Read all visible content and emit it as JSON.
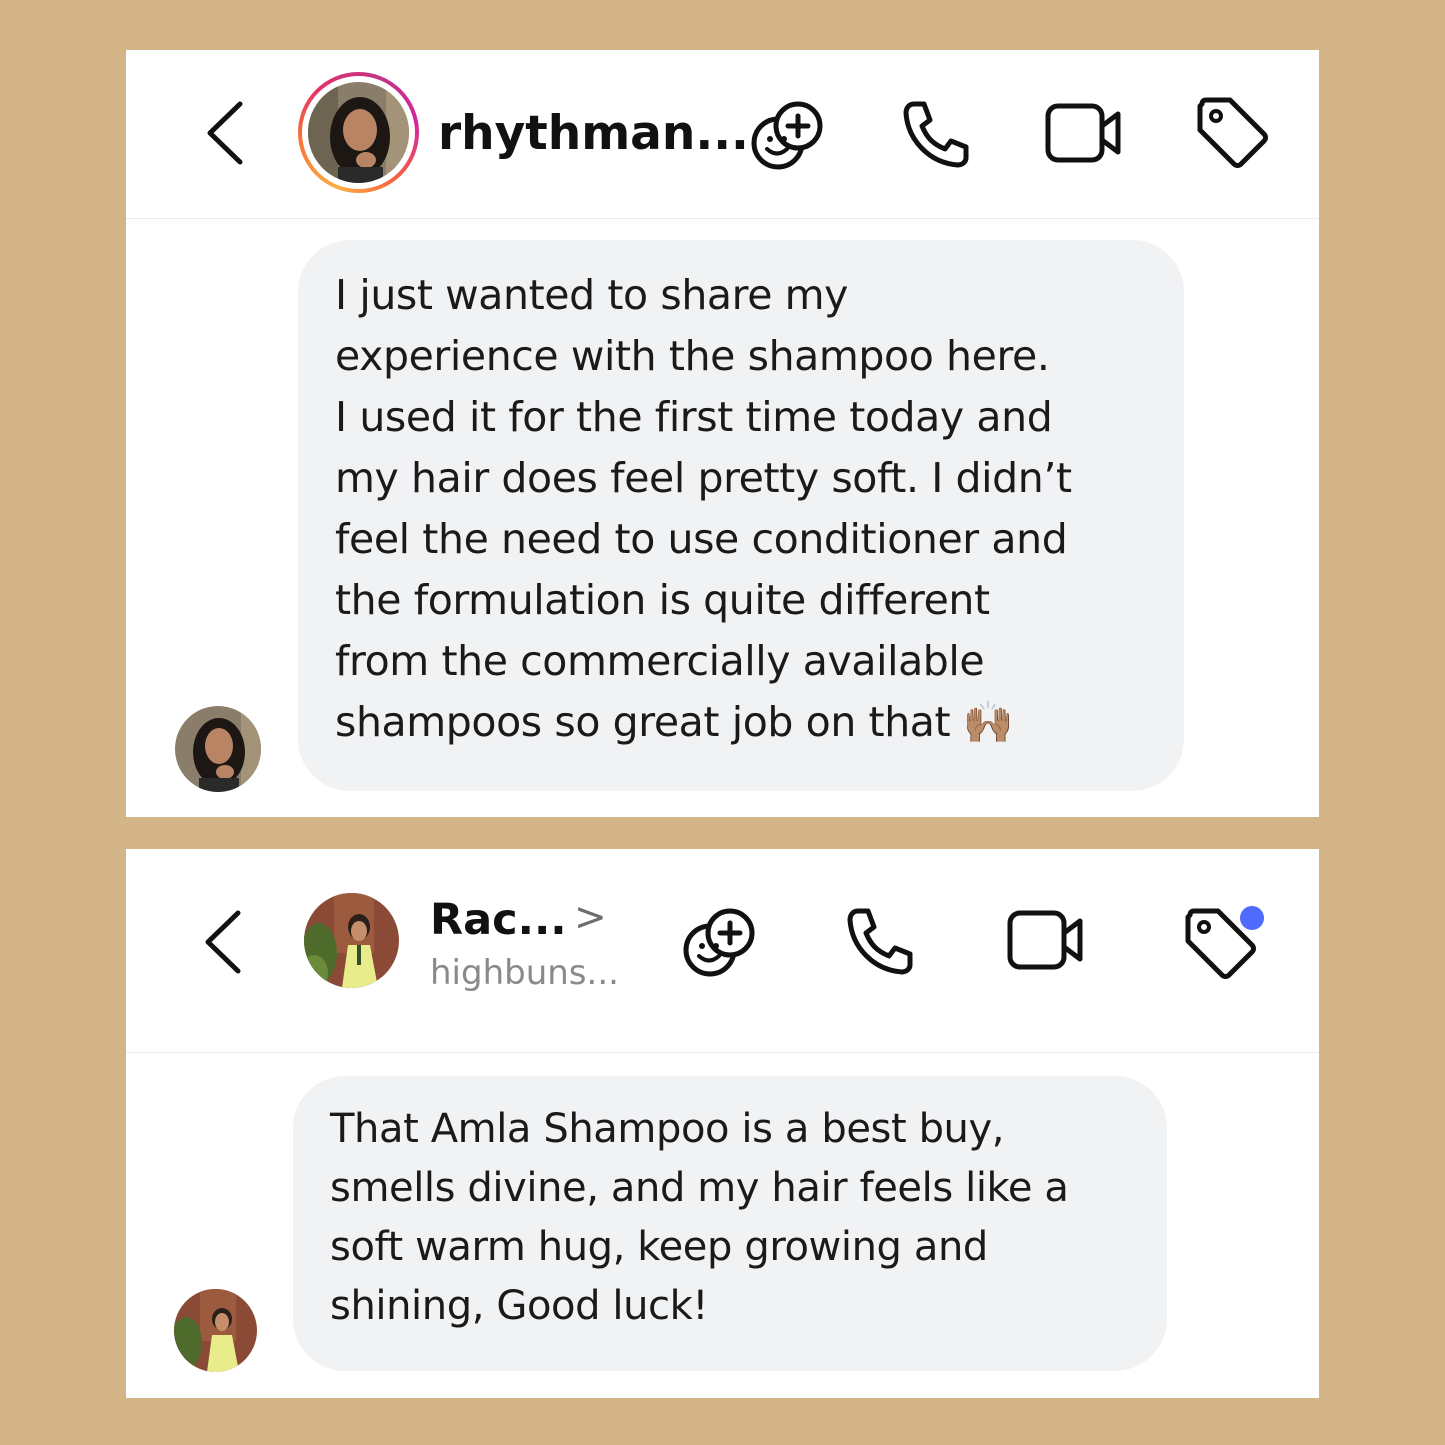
{
  "background_color": "#d4b588",
  "conversation_1": {
    "header": {
      "username": "rhythman...",
      "back_icon": "chevron-left-icon",
      "actions": [
        "sticker-add-icon",
        "phone-icon",
        "video-camera-icon",
        "tag-icon"
      ]
    },
    "message": {
      "lines": [
        "I just wanted to share my",
        "experience with the shampoo here.",
        "I used it for the first time today and",
        "my hair does feel pretty soft. I didn’t",
        "feel the need to use conditioner and",
        "the formulation is quite different",
        "from the commercially available",
        "shampoos so great job on that 🙌🏽"
      ]
    }
  },
  "conversation_2": {
    "header": {
      "name": "Rac...",
      "chevron": ">",
      "subtitle": "highbuns...",
      "back_icon": "chevron-left-icon",
      "actions": [
        "sticker-add-icon",
        "phone-icon",
        "video-camera-icon",
        "tag-icon"
      ],
      "notification_dot_color": "#4f6bff"
    },
    "message": {
      "lines": [
        "That Amla Shampoo is a best buy,",
        "smells divine, and my hair feels like a",
        "soft warm hug, keep growing and",
        "shining, Good luck!"
      ]
    }
  }
}
